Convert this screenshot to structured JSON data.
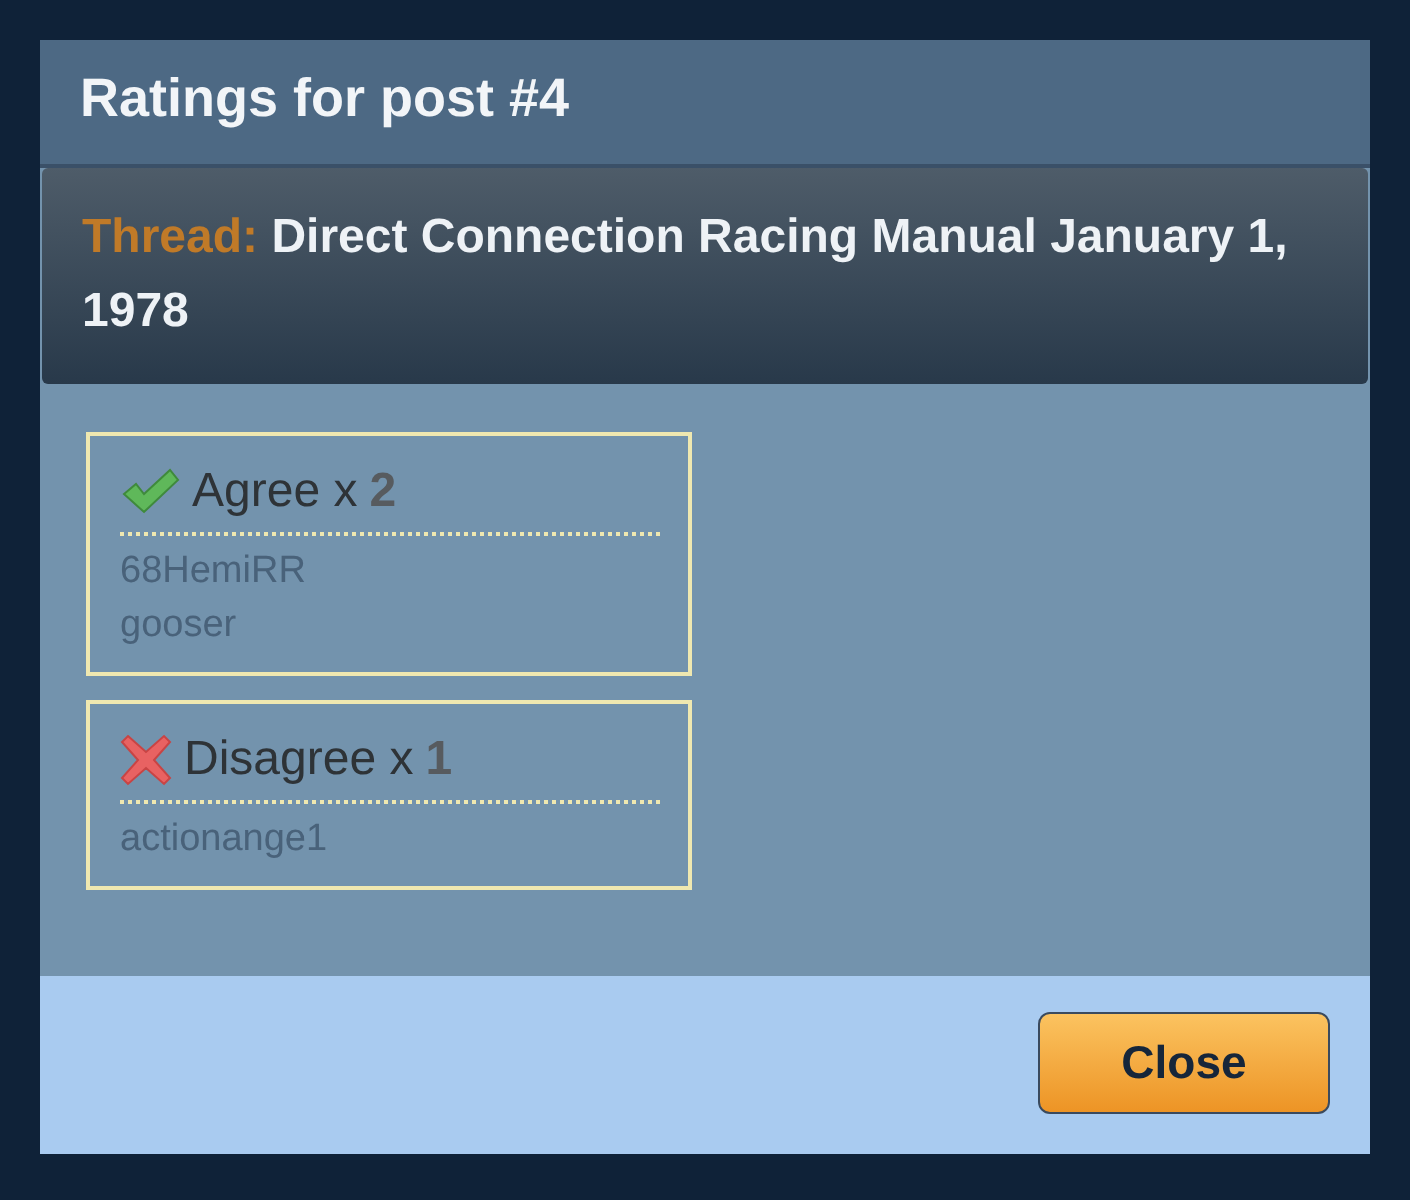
{
  "dialog": {
    "title": "Ratings for post #4"
  },
  "thread": {
    "label": "Thread:",
    "title": "Direct Connection Racing Manual January 1, 1978"
  },
  "ratings": [
    {
      "kind": "agree",
      "label": "Agree x",
      "count": "2",
      "users": [
        "68HemiRR",
        "gooser"
      ]
    },
    {
      "kind": "disagree",
      "label": "Disagree x",
      "count": "1",
      "users": [
        "actionange1"
      ]
    }
  ],
  "buttons": [
    {
      "label": "Close"
    }
  ]
}
